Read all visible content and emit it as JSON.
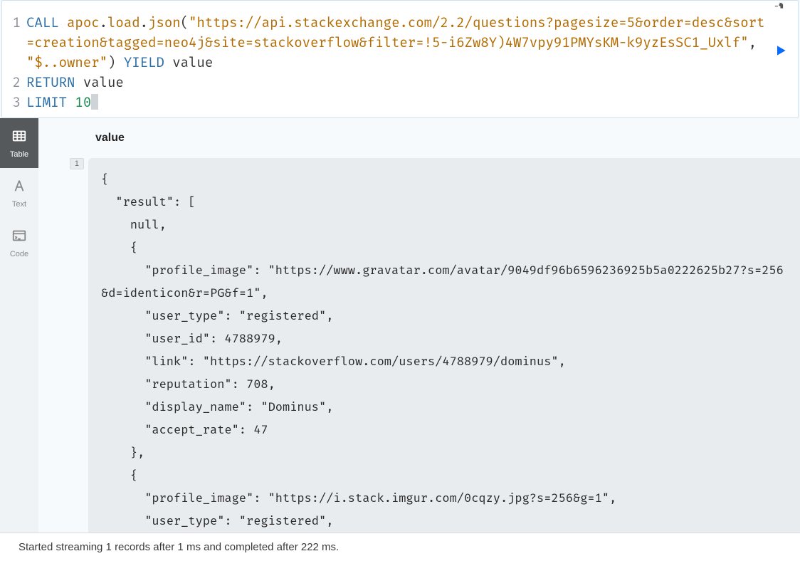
{
  "editor": {
    "line_numbers": [
      "1",
      "2",
      "3"
    ],
    "tokens": {
      "call": "CALL",
      "apoc": "apoc",
      "load": "load",
      "json": "json",
      "url": "\"https://api.stackexchange.com/2.2/questions?pagesize=5&order=desc&sort=creation&tagged=neo4j&site=stackoverflow&filter=!5-i6Zw8Y)4W7vpy91PMYsKM-k9yzEsSC1_Uxlf\"",
      "comma_sp": ", ",
      "path": "\"$..owner\"",
      "yield": "YIELD",
      "value": "value",
      "return_kw": "RETURN",
      "value2": "value",
      "limit_kw": "LIMIT",
      "limit_n": "10"
    }
  },
  "toolbar": {
    "pin_title": "Pin",
    "run_title": "Run"
  },
  "sidebar": {
    "tabs": [
      {
        "id": "table",
        "label": "Table",
        "active": true
      },
      {
        "id": "text",
        "label": "Text",
        "active": false
      },
      {
        "id": "code",
        "label": "Code",
        "active": false
      }
    ]
  },
  "results": {
    "column_label": "value",
    "row_number": "1",
    "json_text": "{\n  \"result\": [\n    null,\n    {\n      \"profile_image\": \"https://www.gravatar.com/avatar/9049df96b6596236925b5a0222625b27?s=256&d=identicon&r=PG&f=1\",\n      \"user_type\": \"registered\",\n      \"user_id\": 4788979,\n      \"link\": \"https://stackoverflow.com/users/4788979/dominus\",\n      \"reputation\": 708,\n      \"display_name\": \"Dominus\",\n      \"accept_rate\": 47\n    },\n    {\n      \"profile_image\": \"https://i.stack.imgur.com/0cqzy.jpg?s=256&g=1\",\n      \"user_type\": \"registered\","
  },
  "status": {
    "text": "Started streaming 1 records after 1 ms and completed after 222 ms."
  }
}
